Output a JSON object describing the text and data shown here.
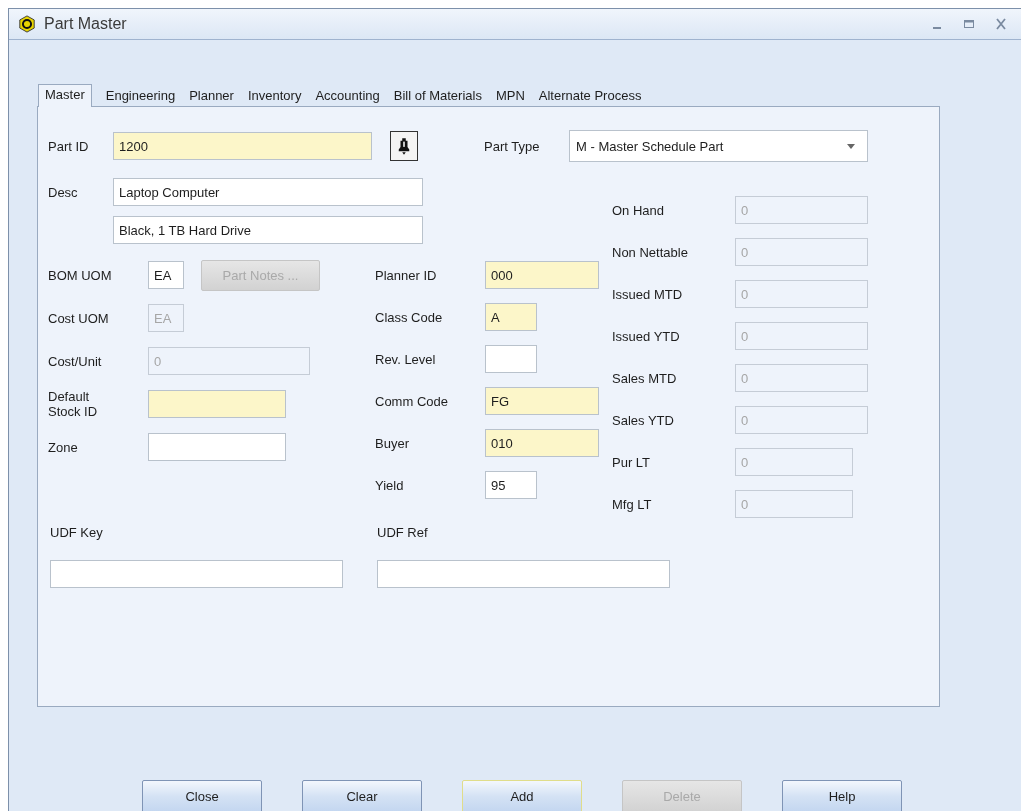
{
  "window": {
    "title": "Part Master"
  },
  "tabs": [
    {
      "label": "Master",
      "selected": true
    },
    {
      "label": "Engineering",
      "selected": false
    },
    {
      "label": "Planner",
      "selected": false
    },
    {
      "label": "Inventory",
      "selected": false
    },
    {
      "label": "Accounting",
      "selected": false
    },
    {
      "label": "Bill of Materials",
      "selected": false
    },
    {
      "label": "MPN",
      "selected": false
    },
    {
      "label": "Alternate Process",
      "selected": false
    }
  ],
  "part_id": {
    "label": "Part ID",
    "value": "1200",
    "required": true,
    "disabled": false
  },
  "part_type": {
    "label": "Part Type",
    "value": "M - Master Schedule Part"
  },
  "description": {
    "label": "Desc",
    "lines": [
      "Laptop Computer",
      "Black, 1 TB Hard Drive"
    ]
  },
  "left_fields": [
    {
      "label": "BOM UOM",
      "value": "EA",
      "required": false,
      "disabled": false,
      "button": {
        "label": "Part Notes ...",
        "disabled": true
      }
    },
    {
      "label": "Cost UOM",
      "value": "EA",
      "disabled": true
    },
    {
      "label": "Cost/Unit",
      "value": "0",
      "disabled": true
    },
    {
      "label": "Default Stock ID",
      "required": true,
      "disabled": false
    },
    {
      "label": "Zone",
      "required": false,
      "disabled": false
    }
  ],
  "middle_fields": [
    {
      "label": "Planner ID",
      "value": "000",
      "required": true,
      "disabled": false
    },
    {
      "label": "Class Code",
      "value": "A",
      "required": true,
      "disabled": false
    },
    {
      "label": "Rev. Level",
      "required": false,
      "disabled": false
    },
    {
      "label": "Comm Code",
      "value": "FG",
      "required": true,
      "disabled": false
    },
    {
      "label": "Buyer",
      "value": "010",
      "required": true,
      "disabled": false
    },
    {
      "label": "Yield",
      "value": "95",
      "required": false,
      "disabled": false
    }
  ],
  "stats_fields": [
    {
      "label": "On Hand",
      "value": "0",
      "disabled": true
    },
    {
      "label": "Non Nettable",
      "value": "0",
      "disabled": true
    },
    {
      "label": "Issued MTD",
      "value": "0",
      "disabled": true
    },
    {
      "label": "Issued YTD",
      "value": "0",
      "disabled": true
    },
    {
      "label": "Sales MTD",
      "value": "0",
      "disabled": true
    },
    {
      "label": "Sales YTD",
      "value": "0",
      "disabled": true
    },
    {
      "label": "Pur LT",
      "value": "0",
      "disabled": true
    },
    {
      "label": "Mfg LT",
      "value": "0",
      "disabled": true
    }
  ],
  "udf_fields": [
    {
      "label": "UDF Key",
      "required": false,
      "disabled": false
    },
    {
      "label": "UDF Ref",
      "required": false,
      "disabled": false
    }
  ],
  "buttons": [
    {
      "label": "Close",
      "disabled": false,
      "default": false
    },
    {
      "label": "Clear",
      "disabled": false,
      "default": false
    },
    {
      "label": "Add",
      "disabled": false,
      "default": true
    },
    {
      "label": "Delete",
      "disabled": true,
      "default": false
    },
    {
      "label": "Help",
      "disabled": false,
      "default": false
    }
  ]
}
